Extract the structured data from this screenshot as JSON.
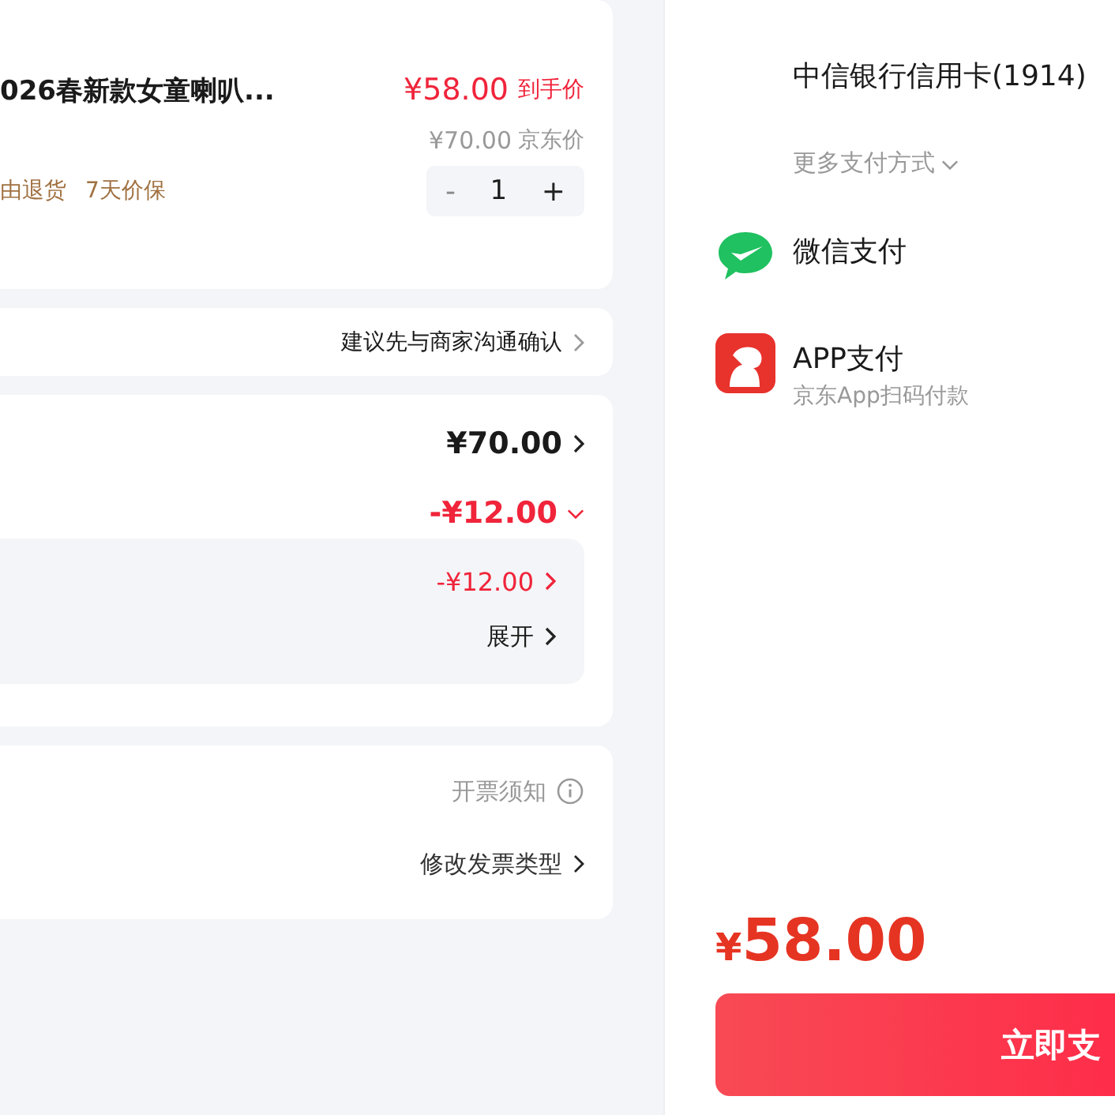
{
  "product": {
    "title": "026春新款女童喇叭...",
    "price": "¥58.00",
    "price_label": "到手价",
    "list_price": "¥70.00",
    "list_price_label": "京东价",
    "tags": [
      "由退货",
      "7天价保"
    ],
    "minus": "-",
    "minus_disabled": true,
    "quantity": "1",
    "plus": "+"
  },
  "note": {
    "text": "建议先与商家沟通确认"
  },
  "summary": {
    "total": "¥70.00",
    "discount": "-¥12.00",
    "discount_expanded": true,
    "detail": {
      "discount": "-¥12.00",
      "toggle": "展开"
    }
  },
  "invoice": {
    "notice": "开票须知",
    "change": "修改发票类型"
  },
  "payment": {
    "card": "中信银行信用卡(1914)",
    "more": "更多支付方式",
    "methods": [
      {
        "kind": "wechat",
        "label": "微信支付"
      },
      {
        "kind": "app",
        "label": "APP支付",
        "sub": "京东App扫码付款"
      }
    ]
  },
  "pay": {
    "currency": "¥",
    "amount": "58.00",
    "button": "立即支"
  }
}
